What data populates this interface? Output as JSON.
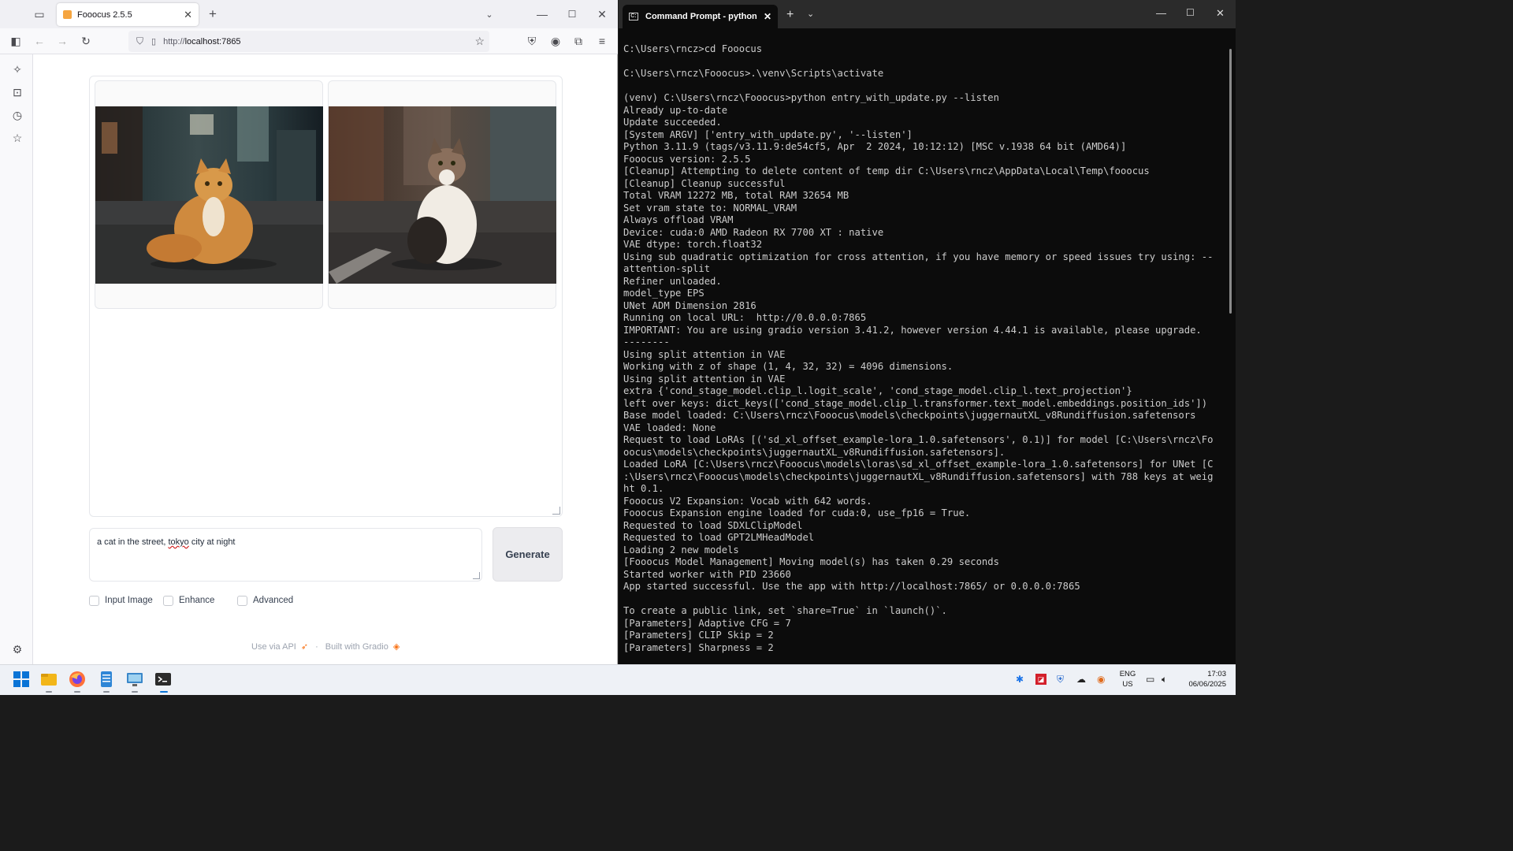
{
  "browser": {
    "tab_title": "Fooocus 2.5.5",
    "url_protocol": "http://",
    "url_host": "localhost:7865"
  },
  "fooocus": {
    "images": [
      {
        "subject": "orange tabby cat sitting on a city street at night"
      },
      {
        "subject": "calico cat sitting on a street at night"
      }
    ],
    "prompt_before": "a cat in the street, ",
    "prompt_misspelled": "tokyo",
    "prompt_after": " city at night",
    "generate_label": "Generate",
    "checkboxes": [
      {
        "label": "Input Image",
        "checked": false
      },
      {
        "label": "Enhance",
        "checked": false
      },
      {
        "label": "Advanced",
        "checked": false
      }
    ],
    "footer_api": "Use via API",
    "footer_sep": "·",
    "footer_built": "Built with Gradio"
  },
  "terminal": {
    "tab_title": "Command Prompt - python  e",
    "lines": [
      "C:\\Users\\rncz>cd Fooocus",
      "",
      "C:\\Users\\rncz\\Fooocus>.\\venv\\Scripts\\activate",
      "",
      "(venv) C:\\Users\\rncz\\Fooocus>python entry_with_update.py --listen",
      "Already up-to-date",
      "Update succeeded.",
      "[System ARGV] ['entry_with_update.py', '--listen']",
      "Python 3.11.9 (tags/v3.11.9:de54cf5, Apr  2 2024, 10:12:12) [MSC v.1938 64 bit (AMD64)]",
      "Fooocus version: 2.5.5",
      "[Cleanup] Attempting to delete content of temp dir C:\\Users\\rncz\\AppData\\Local\\Temp\\fooocus",
      "[Cleanup] Cleanup successful",
      "Total VRAM 12272 MB, total RAM 32654 MB",
      "Set vram state to: NORMAL_VRAM",
      "Always offload VRAM",
      "Device: cuda:0 AMD Radeon RX 7700 XT : native",
      "VAE dtype: torch.float32",
      "Using sub quadratic optimization for cross attention, if you have memory or speed issues try using: --",
      "attention-split",
      "Refiner unloaded.",
      "model_type EPS",
      "UNet ADM Dimension 2816",
      "Running on local URL:  http://0.0.0.0:7865",
      "IMPORTANT: You are using gradio version 3.41.2, however version 4.44.1 is available, please upgrade.",
      "--------",
      "Using split attention in VAE",
      "Working with z of shape (1, 4, 32, 32) = 4096 dimensions.",
      "Using split attention in VAE",
      "extra {'cond_stage_model.clip_l.logit_scale', 'cond_stage_model.clip_l.text_projection'}",
      "left over keys: dict_keys(['cond_stage_model.clip_l.transformer.text_model.embeddings.position_ids'])",
      "Base model loaded: C:\\Users\\rncz\\Fooocus\\models\\checkpoints\\juggernautXL_v8Rundiffusion.safetensors",
      "VAE loaded: None",
      "Request to load LoRAs [('sd_xl_offset_example-lora_1.0.safetensors', 0.1)] for model [C:\\Users\\rncz\\Fo",
      "oocus\\models\\checkpoints\\juggernautXL_v8Rundiffusion.safetensors].",
      "Loaded LoRA [C:\\Users\\rncz\\Fooocus\\models\\loras\\sd_xl_offset_example-lora_1.0.safetensors] for UNet [C",
      ":\\Users\\rncz\\Fooocus\\models\\checkpoints\\juggernautXL_v8Rundiffusion.safetensors] with 788 keys at weig",
      "ht 0.1.",
      "Fooocus V2 Expansion: Vocab with 642 words.",
      "Fooocus Expansion engine loaded for cuda:0, use_fp16 = True.",
      "Requested to load SDXLClipModel",
      "Requested to load GPT2LMHeadModel",
      "Loading 2 new models",
      "[Fooocus Model Management] Moving model(s) has taken 0.29 seconds",
      "Started worker with PID 23660",
      "App started successful. Use the app with http://localhost:7865/ or 0.0.0.0:7865",
      "",
      "To create a public link, set `share=True` in `launch()`.",
      "[Parameters] Adaptive CFG = 7",
      "[Parameters] CLIP Skip = 2",
      "[Parameters] Sharpness = 2"
    ]
  },
  "taskbar": {
    "apps": [
      "windows-start",
      "file-explorer",
      "firefox",
      "notepad",
      "remote-desktop",
      "terminal"
    ],
    "lang_top": "ENG",
    "lang_bottom": "US",
    "time": "17:03",
    "date": "06/06/2025"
  }
}
